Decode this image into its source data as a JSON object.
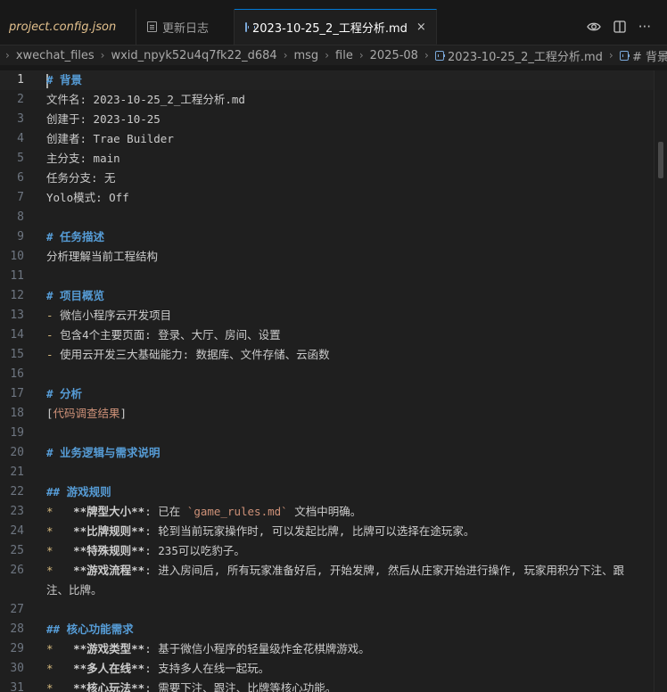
{
  "tabs": [
    {
      "label": "project.config.json"
    },
    {
      "label": "更新日志"
    },
    {
      "label": "2023-10-25_2_工程分析.md",
      "close": "×"
    }
  ],
  "tab_actions": {
    "preview_icon": "eye-icon",
    "split_icon": "split-editor-icon",
    "more": "···"
  },
  "breadcrumb": [
    "xwechat_files",
    "wxid_npyk52u4q7fk22_d684",
    "msg",
    "file",
    "2025-08",
    "2023-10-25_2_工程分析.md",
    "# 背景"
  ],
  "lines": [
    {
      "n": "1",
      "text": "# 背景"
    },
    {
      "n": "2",
      "text": "文件名: 2023-10-25_2_工程分析.md"
    },
    {
      "n": "3",
      "text": "创建于: 2023-10-25"
    },
    {
      "n": "4",
      "text": "创建者: Trae Builder"
    },
    {
      "n": "5",
      "text": "主分支: main"
    },
    {
      "n": "6",
      "text": "任务分支: 无"
    },
    {
      "n": "7",
      "text": "Yolo模式: Off"
    },
    {
      "n": "8",
      "text": ""
    },
    {
      "n": "9",
      "text": "# 任务描述"
    },
    {
      "n": "10",
      "text": "分析理解当前工程结构"
    },
    {
      "n": "11",
      "text": ""
    },
    {
      "n": "12",
      "text": "# 项目概览"
    },
    {
      "n": "13",
      "bullet": "-",
      "text": "微信小程序云开发项目"
    },
    {
      "n": "14",
      "bullet": "-",
      "text": "包含4个主要页面: 登录、大厅、房间、设置"
    },
    {
      "n": "15",
      "bullet": "-",
      "text": "使用云开发三大基础能力: 数据库、文件存储、云函数"
    },
    {
      "n": "16",
      "text": ""
    },
    {
      "n": "17",
      "text": "# 分析"
    },
    {
      "n": "18",
      "open": "[",
      "link": "代码调查结果",
      "close": "]"
    },
    {
      "n": "19",
      "text": ""
    },
    {
      "n": "20",
      "text": "# 业务逻辑与需求说明"
    },
    {
      "n": "21",
      "text": ""
    },
    {
      "n": "22",
      "text": "## 游戏规则"
    },
    {
      "n": "23",
      "bullet": "*",
      "bold": "**牌型大小**",
      "pre": ": 已在 ",
      "code": "`game_rules.md`",
      "post": " 文档中明确。"
    },
    {
      "n": "24",
      "bullet": "*",
      "bold": "**比牌规则**",
      "post": ": 轮到当前玩家操作时, 可以发起比牌, 比牌可以选择在途玩家。"
    },
    {
      "n": "25",
      "bullet": "*",
      "bold": "**特殊规则**",
      "post": ": 235可以吃豹子。"
    },
    {
      "n": "26",
      "bullet": "*",
      "bold": "**游戏流程**",
      "post": ": 进入房间后, 所有玩家准备好后, 开始发牌, 然后从庄家开始进行操作, 玩家用积分下注、跟注、比牌。"
    },
    {
      "n": "27",
      "text": ""
    },
    {
      "n": "28",
      "text": "## 核心功能需求"
    },
    {
      "n": "29",
      "bullet": "*",
      "bold": "**游戏类型**",
      "post": ": 基于微信小程序的轻量级炸金花棋牌游戏。"
    },
    {
      "n": "30",
      "bullet": "*",
      "bold": "**多人在线**",
      "post": ": 支持多人在线一起玩。"
    },
    {
      "n": "31",
      "bullet": "*",
      "bold": "**核心玩法**",
      "post": ": 需要下注、跟注、比牌等核心功能。"
    }
  ]
}
